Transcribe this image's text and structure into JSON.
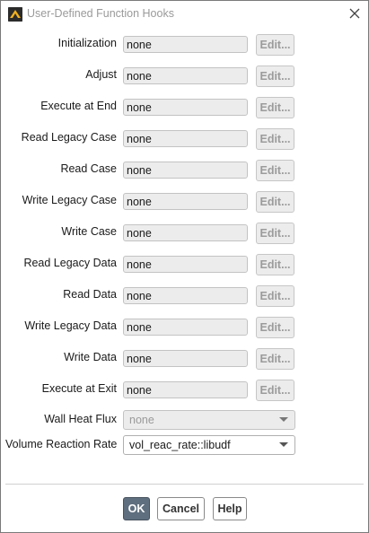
{
  "window": {
    "title": "User-Defined Function Hooks",
    "icon": "ansys-fluent-app-icon",
    "close_icon": "close-icon"
  },
  "hooks": [
    {
      "label": "Initialization",
      "value": "none",
      "edit_label": "Edit..."
    },
    {
      "label": "Adjust",
      "value": "none",
      "edit_label": "Edit..."
    },
    {
      "label": "Execute at End",
      "value": "none",
      "edit_label": "Edit..."
    },
    {
      "label": "Read Legacy Case",
      "value": "none",
      "edit_label": "Edit..."
    },
    {
      "label": "Read Case",
      "value": "none",
      "edit_label": "Edit..."
    },
    {
      "label": "Write Legacy Case",
      "value": "none",
      "edit_label": "Edit..."
    },
    {
      "label": "Write Case",
      "value": "none",
      "edit_label": "Edit..."
    },
    {
      "label": "Read Legacy Data",
      "value": "none",
      "edit_label": "Edit..."
    },
    {
      "label": "Read Data",
      "value": "none",
      "edit_label": "Edit..."
    },
    {
      "label": "Write Legacy Data",
      "value": "none",
      "edit_label": "Edit..."
    },
    {
      "label": "Write Data",
      "value": "none",
      "edit_label": "Edit..."
    },
    {
      "label": "Execute at Exit",
      "value": "none",
      "edit_label": "Edit..."
    }
  ],
  "wall_heat_flux": {
    "label": "Wall Heat Flux",
    "selected": "none",
    "enabled": false
  },
  "volume_reaction_rate": {
    "label": "Volume Reaction Rate",
    "selected": "vol_reac_rate::libudf",
    "enabled": true
  },
  "buttons": {
    "ok": "OK",
    "cancel": "Cancel",
    "help": "Help"
  },
  "colors": {
    "ok_button_bg": "#5f6f7f",
    "disabled_text": "#9b9b9b"
  }
}
